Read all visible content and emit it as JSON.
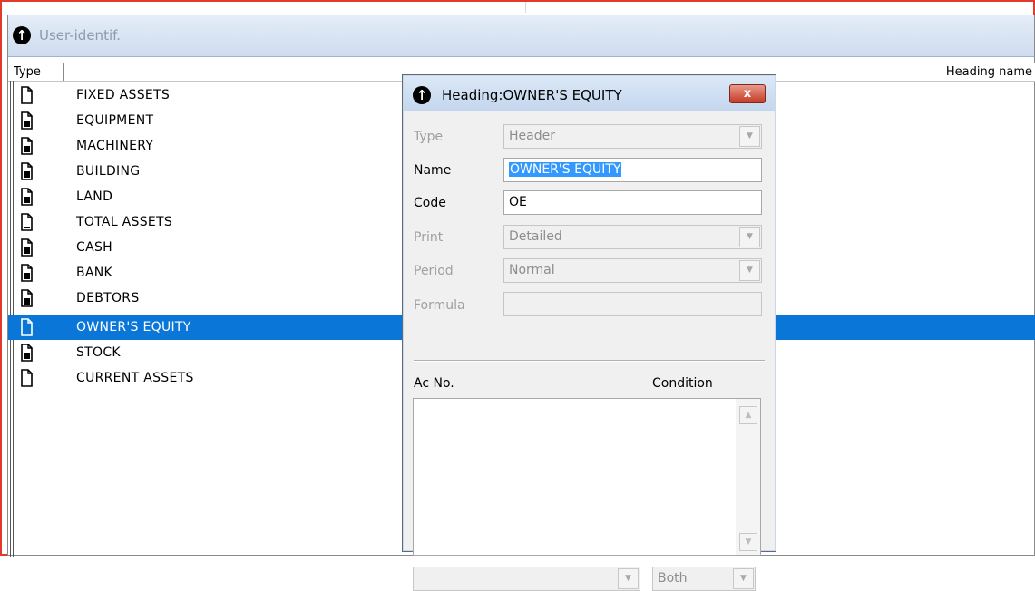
{
  "main_window": {
    "title": "User-identif.",
    "columns": {
      "type": "Type",
      "heading_name": "Heading name"
    }
  },
  "headings": [
    {
      "label": "FIXED ASSETS",
      "icon": "empty-doc-icon"
    },
    {
      "label": "EQUIPMENT",
      "icon": "filled-doc-icon"
    },
    {
      "label": "MACHINERY",
      "icon": "filled-doc-icon"
    },
    {
      "label": "BUILDING",
      "icon": "filled-doc-icon"
    },
    {
      "label": "LAND",
      "icon": "filled-doc-icon"
    },
    {
      "label": "TOTAL ASSETS",
      "icon": "total-doc-icon"
    },
    {
      "label": "CASH",
      "icon": "filled-doc-icon"
    },
    {
      "label": "BANK",
      "icon": "filled-doc-icon"
    },
    {
      "label": "DEBTORS",
      "icon": "filled-doc-icon"
    },
    {
      "label": "OWNER'S EQUITY",
      "icon": "empty-doc-icon",
      "selected": true
    },
    {
      "label": "STOCK",
      "icon": "filled-doc-icon"
    },
    {
      "label": "CURRENT ASSETS",
      "icon": "empty-doc-icon"
    }
  ],
  "dialog": {
    "title": "Heading:OWNER'S EQUITY",
    "close_label": "x",
    "type_label": "Type",
    "type_value": "Header",
    "name_label": "Name",
    "name_value": "OWNER'S EQUITY",
    "code_label": "Code",
    "code_value": "OE",
    "print_label": "Print",
    "print_value": "Detailed",
    "period_label": "Period",
    "period_value": "Normal",
    "formula_label": "Formula",
    "formula_value": "",
    "acno_label": "Ac No.",
    "condition_label": "Condition",
    "bottom_left_value": "",
    "bottom_right_value": "Both"
  },
  "colors": {
    "selection": "#0a77d8",
    "frame_border": "#e03a2c",
    "close_button": "#c53a24"
  }
}
